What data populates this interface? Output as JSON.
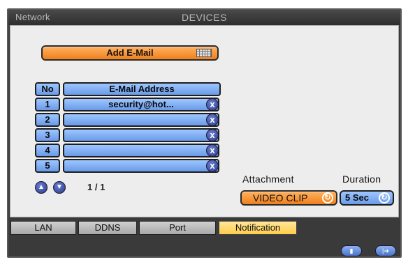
{
  "title_bar": {
    "left": "Network",
    "center": "DEVICES"
  },
  "add_email": {
    "label": "Add E-Mail",
    "icon": "keyboard-icon"
  },
  "table": {
    "header_no": "No",
    "header_address": "E-Mail Address",
    "rows": [
      {
        "no": "1",
        "address": "security@hot..."
      },
      {
        "no": "2",
        "address": ""
      },
      {
        "no": "3",
        "address": ""
      },
      {
        "no": "4",
        "address": ""
      },
      {
        "no": "5",
        "address": ""
      }
    ],
    "delete_icon": "x"
  },
  "pagination": {
    "indicator": "1 / 1",
    "up_icon": "up-arrow-icon",
    "down_icon": "down-arrow-icon"
  },
  "attachment": {
    "label": "Attachment",
    "value": "VIDEO CLIP"
  },
  "duration": {
    "label": "Duration",
    "value": "5 Sec"
  },
  "tabs": [
    "LAN",
    "DDNS",
    "Port",
    "Notification"
  ],
  "active_tab": "Notification",
  "bottom_buttons": {
    "save_icon": "save-icon",
    "exit_icon": "exit-icon"
  },
  "colors": {
    "accent_orange": "#f07f1c",
    "cell_blue": "#6a9be8",
    "active_tab_yellow": "#ffcc4a",
    "window_dark": "#3a3a3a"
  }
}
